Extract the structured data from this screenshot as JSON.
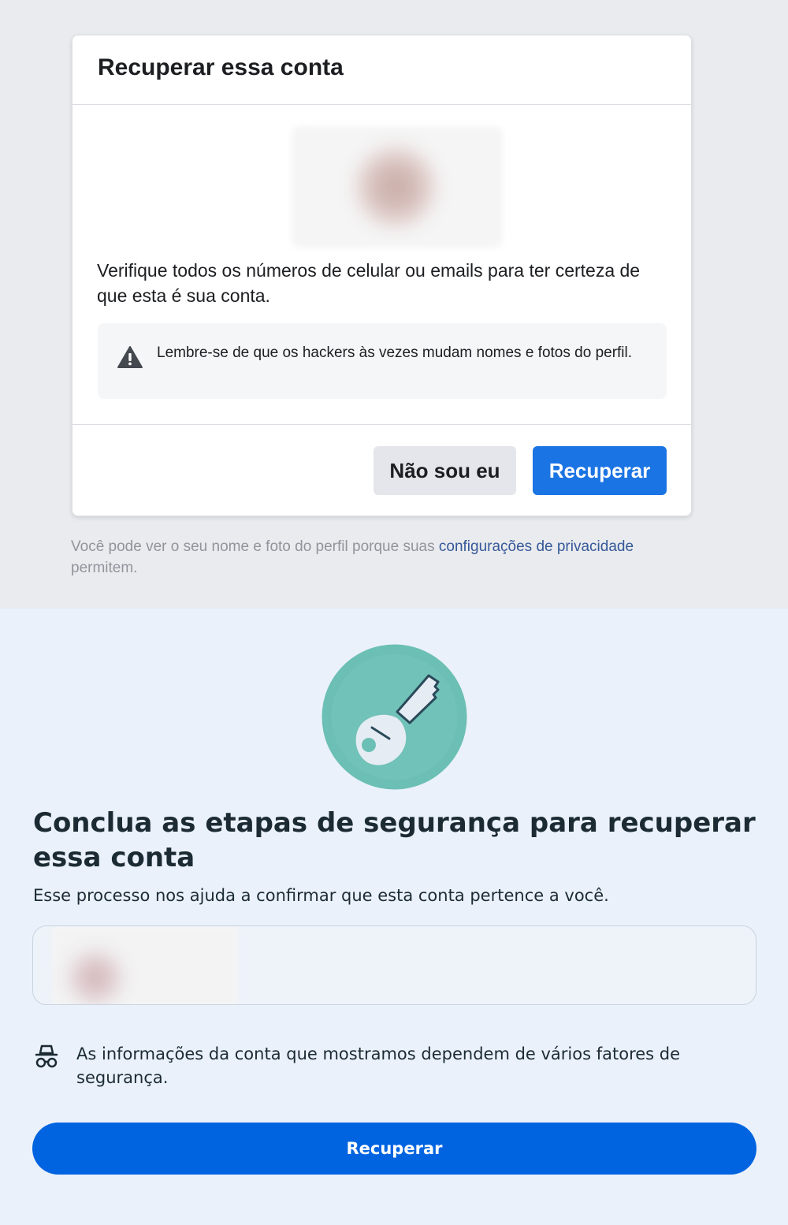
{
  "dialog": {
    "title": "Recuperar essa conta",
    "verify_text": "Verifique todos os números de celular ou emails para ter certeza de que esta é sua conta.",
    "warning_text": "Lembre-se de que os hackers às vezes mudam nomes e fotos do perfil.",
    "not_me_label": "Não sou eu",
    "recover_label": "Recuperar",
    "recover_color": "#1b74e4"
  },
  "privacy": {
    "text_before": "Você pode ver o seu nome e foto do perfil porque suas ",
    "link_text": "configurações de privacidade",
    "text_after": " permitem."
  },
  "security": {
    "title": "Conclua as etapas de segurança para recuperar essa conta",
    "subtitle": "Esse processo nos ajuda a confirmar que esta conta pertence a você.",
    "info_text": "As informações da conta que mostramos dependem de vários fatores de segurança.",
    "recover_label": "Recuperar",
    "recover_color": "#0064e0",
    "key_circle_color": "#6cbfb5"
  }
}
